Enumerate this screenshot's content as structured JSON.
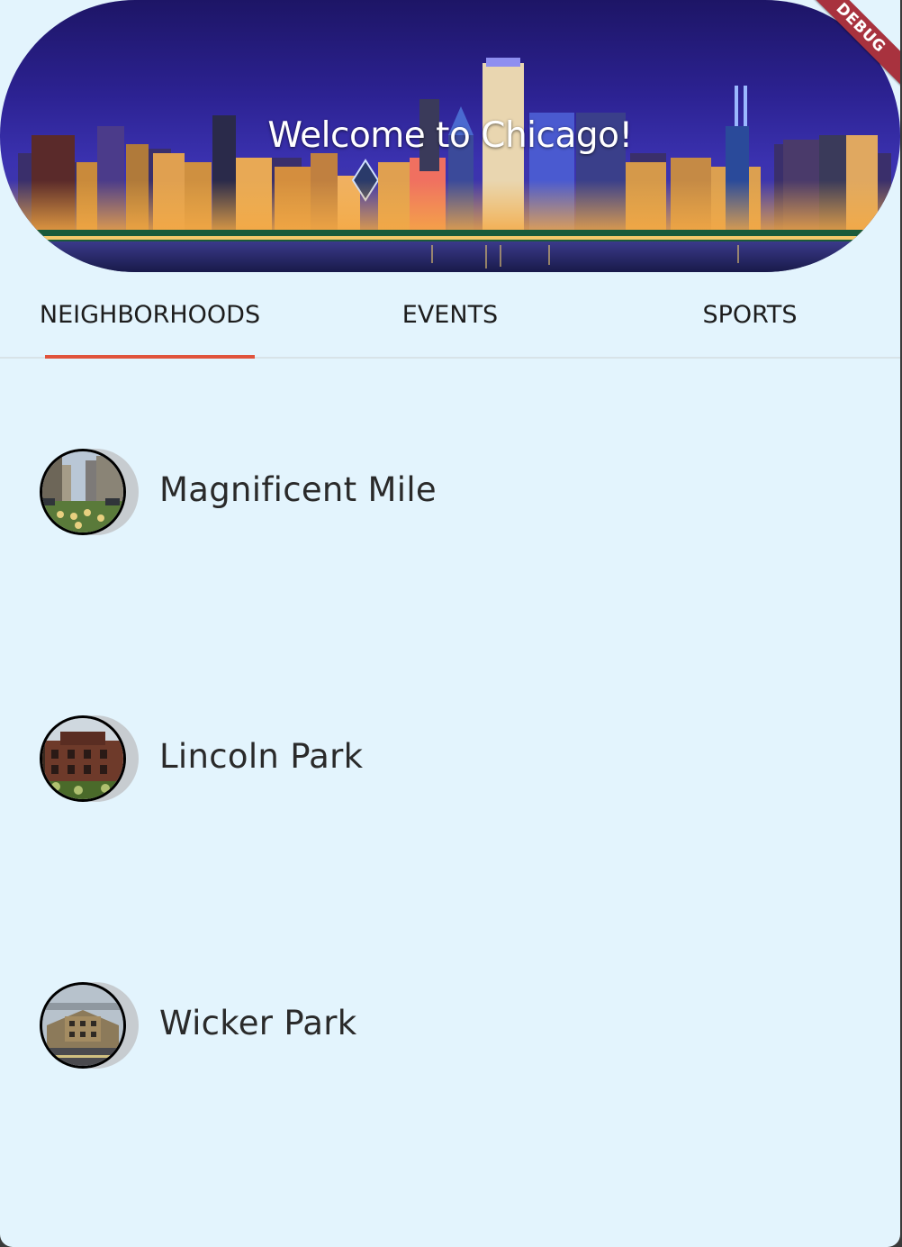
{
  "header": {
    "title": "Welcome to Chicago!",
    "debug_label": "DEBUG"
  },
  "tabs": [
    {
      "label": "NEIGHBORHOODS",
      "selected": true
    },
    {
      "label": "EVENTS",
      "selected": false
    },
    {
      "label": "SPORTS",
      "selected": false
    }
  ],
  "neighborhoods": [
    {
      "label": "Magnificent Mile",
      "icon": "magnificent-mile-photo"
    },
    {
      "label": "Lincoln Park",
      "icon": "lincoln-park-photo"
    },
    {
      "label": "Wicker Park",
      "icon": "wicker-park-photo"
    }
  ],
  "colors": {
    "background": "#e3f4fd",
    "tab_indicator": "#e0533c",
    "debug_banner": "#a8323e"
  }
}
